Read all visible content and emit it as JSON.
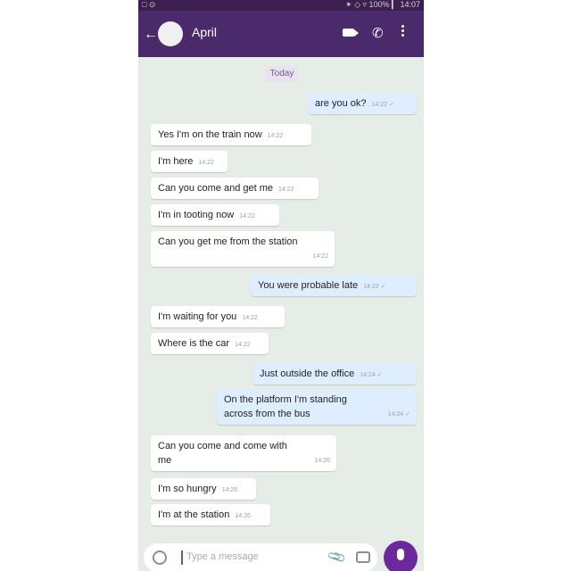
{
  "status_bar": {
    "left": "□ ⊙",
    "right": "✶ ◇ ▿ 100% ▎ 14:07"
  },
  "header": {
    "contact_name": "April",
    "back_glyph": "←"
  },
  "date_label": "Today",
  "messages": [
    {
      "direction": "out",
      "text": "are you ok?",
      "time": "14:22 ✓"
    },
    {
      "direction": "in",
      "text": "Yes I'm on the train now",
      "time": "14:22"
    },
    {
      "direction": "in",
      "text": "I'm here",
      "time": "14:22"
    },
    {
      "direction": "in",
      "text": "Can you come and get me",
      "time": "14:22"
    },
    {
      "direction": "in",
      "text": "I'm in tooting now",
      "time": "14:22"
    },
    {
      "direction": "in",
      "text": "Can you get me from the station",
      "time": "14:22"
    },
    {
      "direction": "out",
      "text": "You were probable late",
      "time": "14:22 ✓"
    },
    {
      "direction": "in",
      "text": "I'm waiting for you",
      "time": "14:22"
    },
    {
      "direction": "in",
      "text": "Where is the car",
      "time": "14:22"
    },
    {
      "direction": "out",
      "text": "Just outside the office",
      "time": "14:24 ✓"
    },
    {
      "direction": "out",
      "text": "On the platform I'm standing across from the bus",
      "time": "14:24 ✓"
    },
    {
      "direction": "in",
      "text": "Can you come and come with me",
      "time": "14:26"
    },
    {
      "direction": "in",
      "text": "I'm so hungry",
      "time": "14:26"
    },
    {
      "direction": "in",
      "text": "I'm at the station",
      "time": "14:26"
    }
  ],
  "composer": {
    "placeholder": "Type a message"
  }
}
